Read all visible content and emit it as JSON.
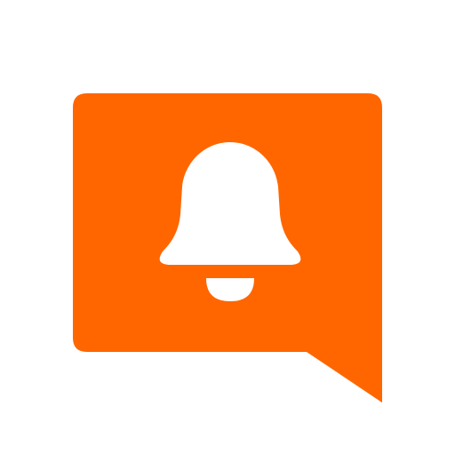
{
  "app_icon": {
    "name": "notification-speech-bubble",
    "icon_names": [
      "speech-bubble-icon",
      "bell-icon"
    ],
    "colors": {
      "bubble": "#FF6600",
      "bell": "#FFFFFF",
      "background": "#FFFFFF"
    }
  }
}
